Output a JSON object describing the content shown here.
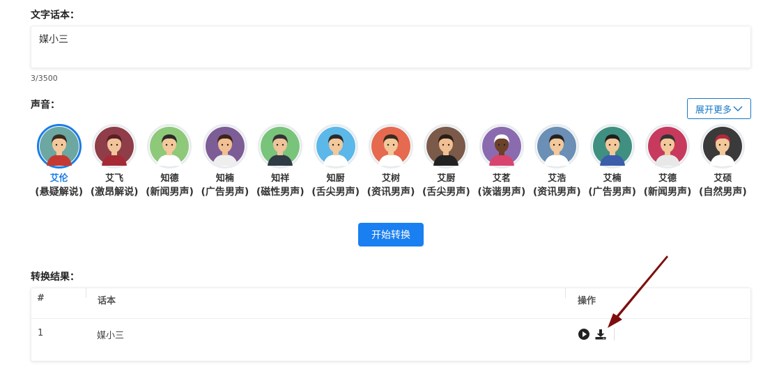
{
  "text_section": {
    "title": "文字话本：",
    "value": "媒小三",
    "char_count": "3/3500"
  },
  "voice_section": {
    "title": "声音：",
    "expand_label": "展开更多",
    "voices": [
      {
        "name": "艾伦",
        "style": "(悬疑解说)",
        "selected": true,
        "bg": "#6ca7a2",
        "skin": "#f3c89a",
        "hair": "#3a2a20",
        "shirt": "#c43a32"
      },
      {
        "name": "艾飞",
        "style": "(激昂解说)",
        "selected": false,
        "bg": "#8f3d48",
        "skin": "#f2c49a",
        "hair": "#5a1e25",
        "shirt": "#a52a35"
      },
      {
        "name": "知德",
        "style": "(新闻男声)",
        "selected": false,
        "bg": "#8ec97a",
        "skin": "#f3c89a",
        "hair": "#2a2a2a",
        "shirt": "#ffffff"
      },
      {
        "name": "知楠",
        "style": "(广告男声)",
        "selected": false,
        "bg": "#7d5d95",
        "skin": "#f1c093",
        "hair": "#3b2418",
        "shirt": "#eeeeee"
      },
      {
        "name": "知祥",
        "style": "(磁性男声)",
        "selected": false,
        "bg": "#79c47b",
        "skin": "#f0c39b",
        "hair": "#333333",
        "shirt": "#2f3b45"
      },
      {
        "name": "知厨",
        "style": "(舌尖男声)",
        "selected": false,
        "bg": "#5bb8e8",
        "skin": "#f3c89a",
        "hair": "#2a2a2a",
        "shirt": "#ffffff"
      },
      {
        "name": "艾树",
        "style": "(资讯男声)",
        "selected": false,
        "bg": "#e56a4f",
        "skin": "#f3c89a",
        "hair": "#3a2a20",
        "shirt": "#ffffff"
      },
      {
        "name": "艾厨",
        "style": "(舌尖男声)",
        "selected": false,
        "bg": "#7b5a4a",
        "skin": "#f0bf92",
        "hair": "#2a1d16",
        "shirt": "#222222"
      },
      {
        "name": "艾茗",
        "style": "(诙谐男声)",
        "selected": false,
        "bg": "#8b6bb0",
        "skin": "#6b4129",
        "hair": "#ffffff",
        "shirt": "#d9446e"
      },
      {
        "name": "艾浩",
        "style": "(资讯男声)",
        "selected": false,
        "bg": "#6b8fb5",
        "skin": "#f3c89a",
        "hair": "#222222",
        "shirt": "#ffffff"
      },
      {
        "name": "艾楠",
        "style": "(广告男声)",
        "selected": false,
        "bg": "#3f9080",
        "skin": "#f3c89a",
        "hair": "#1e1e1e",
        "shirt": "#3b5dab"
      },
      {
        "name": "艾德",
        "style": "(新闻男声)",
        "selected": false,
        "bg": "#c73a5e",
        "skin": "#f3c89a",
        "hair": "#333333",
        "shirt": "#e8e8e8"
      },
      {
        "name": "艾硕",
        "style": "(自然男声)",
        "selected": false,
        "bg": "#3a3a3a",
        "skin": "#f3c89a",
        "hair": "#b02a3e",
        "shirt": "#ffffff"
      }
    ]
  },
  "start_button": "开始转换",
  "result_section": {
    "title": "转换结果：",
    "columns": [
      "#",
      "话本",
      "操作"
    ],
    "rows": [
      {
        "index": "1",
        "text": "媒小三"
      }
    ]
  },
  "icons": {
    "expand": "chevron-down-icon",
    "play": "play-icon",
    "download": "download-icon"
  },
  "colors": {
    "accent": "#1a7ff0",
    "selected": "#1b7de6",
    "arrow": "#7a0b0b"
  }
}
